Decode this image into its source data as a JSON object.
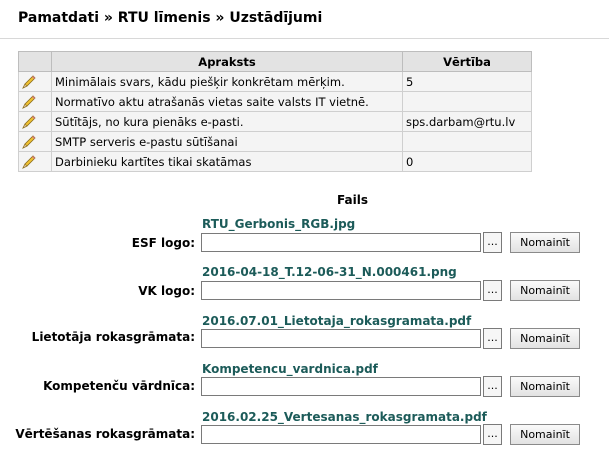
{
  "breadcrumb": "Pamatdati » RTU līmenis » Uzstādījumi",
  "settings_table": {
    "headers": {
      "description": "Apraksts",
      "value": "Vērtība"
    },
    "rows": [
      {
        "description": "Minimālais svars, kādu piešķir konkrētam mērķim.",
        "value": "5"
      },
      {
        "description": "Normatīvo aktu atrašanās vietas saite valsts IT vietnē.",
        "value": ""
      },
      {
        "description": "Sūtītājs, no kura pienāks e-pasti.",
        "value": "sps.darbam@rtu.lv"
      },
      {
        "description": "SMTP serveris e-pastu sūtīšanai",
        "value": ""
      },
      {
        "description": "Darbinieku kartītes tikai skatāmas",
        "value": "0"
      }
    ],
    "edit_icon": "pencil-icon"
  },
  "files": {
    "title": "Fails",
    "browse_label": "...",
    "button_label": "Nomainīt",
    "items": [
      {
        "label": "ESF logo:",
        "filename": "RTU_Gerbonis_RGB.jpg"
      },
      {
        "label": "VK logo:",
        "filename": "2016-04-18_T.12-06-31_N.000461.png"
      },
      {
        "label": "Lietotāja rokasgrāmata:",
        "filename": "2016.07.01_Lietotaja_rokasgramata.pdf"
      },
      {
        "label": "Kompetenču vārdnīca:",
        "filename": "Kompetencu_vardnica.pdf"
      },
      {
        "label": "Vērtēšanas rokasgrāmata:",
        "filename": "2016.02.25_Vertesanas_rokasgramata.pdf"
      }
    ]
  }
}
